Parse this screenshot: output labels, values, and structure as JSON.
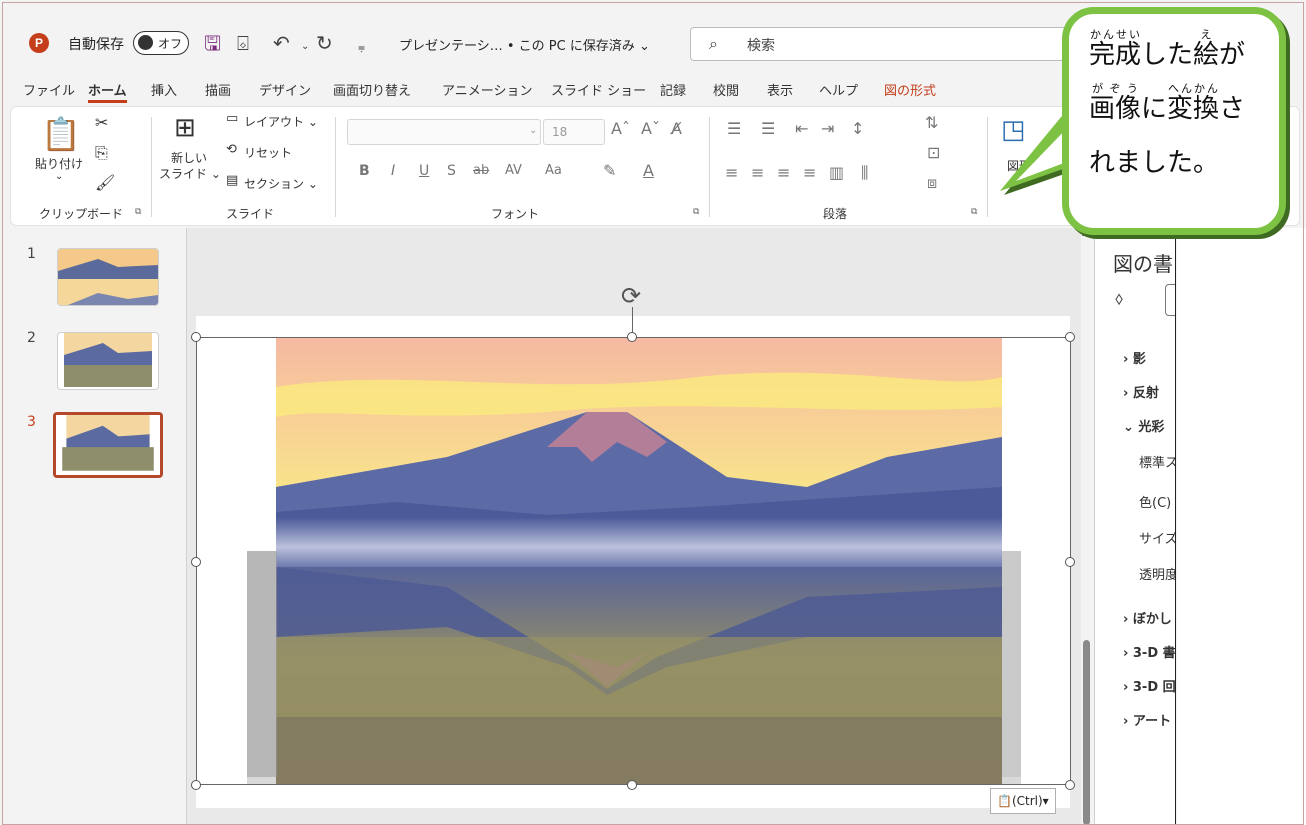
{
  "titlebar": {
    "app_icon": "P",
    "autosave_label": "自動保存",
    "autosave_state": "オフ",
    "doc_title": "プレゼンテーシ… • この PC に保存済み ⌄",
    "search_placeholder": "検索"
  },
  "tabs": [
    "ファイル",
    "ホーム",
    "挿入",
    "描画",
    "デザイン",
    "画面切り替え",
    "アニメーション",
    "スライド ショー",
    "記録",
    "校閲",
    "表示",
    "ヘルプ",
    "図の形式"
  ],
  "ribbon": {
    "clipboard": {
      "paste": "貼り付け",
      "group": "クリップボード"
    },
    "slides": {
      "new_slide_1": "新しい",
      "new_slide_2": "スライド ⌄",
      "layout": "レイアウト ⌄",
      "reset": "リセット",
      "section": "セクション ⌄",
      "group": "スライド"
    },
    "font": {
      "size": "18",
      "bold": "B",
      "italic": "I",
      "underline": "U",
      "shadow": "S",
      "strike": "ab",
      "spacing": "AV",
      "case": "Aa",
      "group": "フォント"
    },
    "paragraph": {
      "group": "段落"
    },
    "shapes": {
      "label": "図形"
    }
  },
  "slides": [
    {
      "number": "1"
    },
    {
      "number": "2"
    },
    {
      "number": "3"
    }
  ],
  "canvas": {
    "paste_options": "(Ctrl)"
  },
  "format_pane": {
    "title": "図の書",
    "items": [
      "影",
      "反射",
      "光彩",
      "標準ス",
      "色(C)",
      "サイズ(",
      "透明度",
      "ぼかし",
      "3-D 書",
      "3-D 回",
      "アート"
    ]
  },
  "callout": {
    "line1_base1": "完成",
    "line1_ruby1": "かんせい",
    "line1_mid": "した",
    "line1_base2": "絵",
    "line1_ruby2": "え",
    "line1_end": "が",
    "line2_base1": "画像",
    "line2_ruby1": "がぞう",
    "line2_mid": "に",
    "line2_base2": "変換",
    "line2_ruby2": "へんかん",
    "line2_end": "さ",
    "line3": "れました。"
  },
  "colors": {
    "accent": "#c43e1c",
    "bubble_border": "#7dc243",
    "bubble_shadow": "#3f6a22"
  }
}
